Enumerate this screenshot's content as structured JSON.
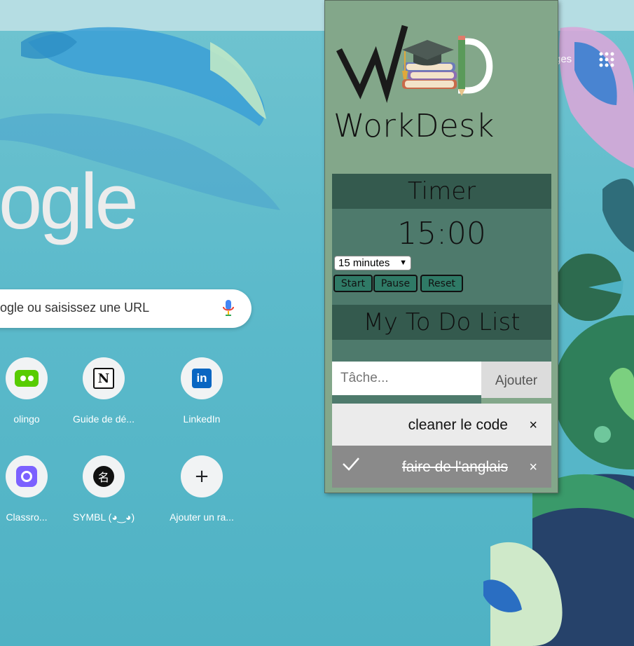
{
  "background": {
    "google_logo_text": "ogle",
    "search_placeholder": "ogle ou saisissez une URL",
    "images_link": "ges",
    "shortcuts": [
      {
        "label": "olingo"
      },
      {
        "label": "Guide de dé..."
      },
      {
        "label": "LinkedIn"
      },
      {
        "label": "Classro..."
      },
      {
        "label": "SYMBL (◕‿◕)"
      },
      {
        "label": "Ajouter un ra..."
      }
    ],
    "shortcut_glyphs": {
      "notion": "N",
      "linkedin": "in",
      "symbl": "名",
      "add": "+"
    }
  },
  "popup": {
    "brand_name": "WorkDesk",
    "timer": {
      "heading": "Timer",
      "display": "15:00",
      "duration_selected": "15 minutes",
      "start_label": "Start",
      "pause_label": "Pause",
      "reset_label": "Reset"
    },
    "todo": {
      "heading": "My To Do List",
      "input_placeholder": "Tâche...",
      "add_label": "Ajouter",
      "close_glyph": "×",
      "tasks": [
        {
          "text": "cleaner le code",
          "done": false
        },
        {
          "text": "faire de l'anglais",
          "done": true
        }
      ]
    }
  },
  "colors": {
    "popup_bg": "#83a78a",
    "header_bg": "#345a4e",
    "timer_bg": "#4e7a6c",
    "button_bg": "#2f7a66",
    "task_bg": "#ebebeb",
    "task_done_bg": "#8a8a8a"
  }
}
